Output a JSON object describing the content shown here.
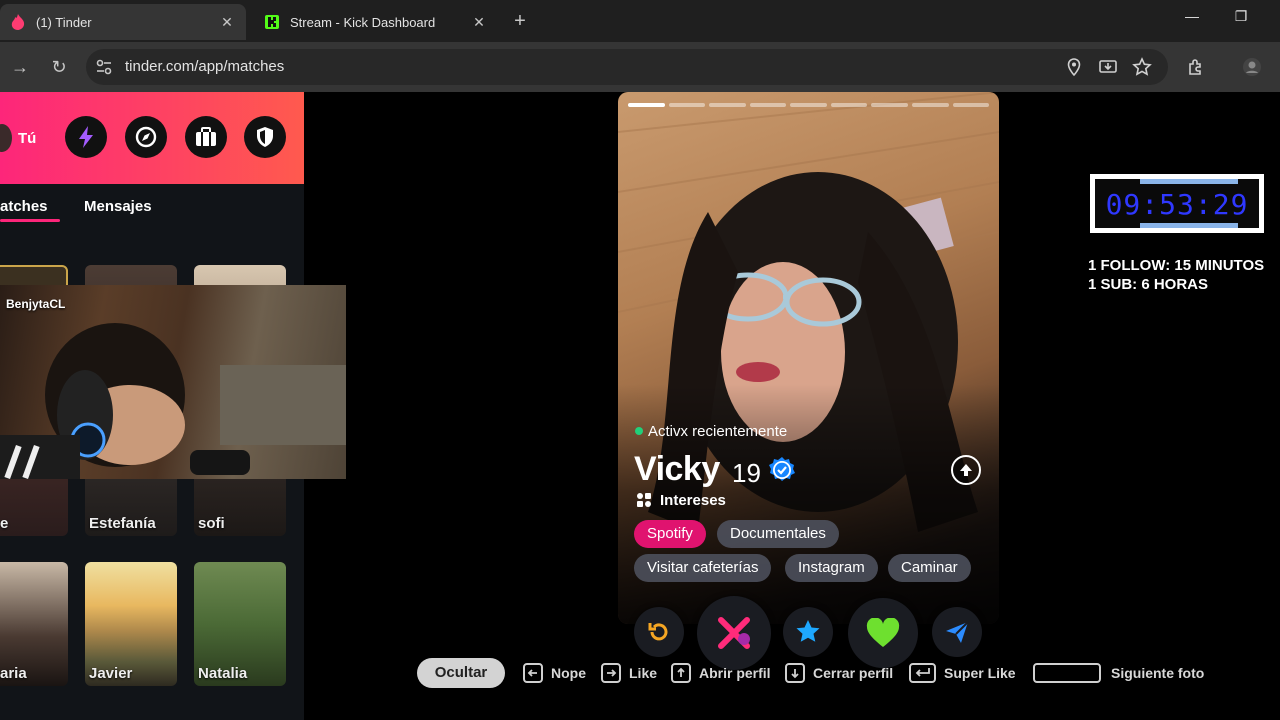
{
  "browser": {
    "tabs": [
      {
        "title": "(1) Tinder",
        "active": true,
        "icon": "tinder-flame-icon"
      },
      {
        "title": "Stream - Kick Dashboard",
        "active": false,
        "icon": "kick-logo-icon"
      }
    ],
    "url": "tinder.com/app/matches"
  },
  "sidebar": {
    "user_label": "Tú",
    "tabs": [
      "Matches",
      "Mensajes"
    ],
    "active_tab": "Matches",
    "matches_tab_visible": "atches",
    "cards_row2": [
      {
        "name": "e"
      },
      {
        "name": "Estefanía"
      },
      {
        "name": "sofi"
      }
    ],
    "cards_row3": [
      {
        "name": "aria"
      },
      {
        "name": "Javier"
      },
      {
        "name": "Natalia"
      }
    ]
  },
  "webcam": {
    "channel": "BenjytaCL"
  },
  "profile": {
    "status": "Activx recientemente",
    "name": "Vicky",
    "age": "19",
    "interests_label": "Intereses",
    "interests": [
      "Spotify",
      "Documentales",
      "Visitar cafeterías",
      "Instagram",
      "Caminar"
    ],
    "highlighted_interest": "Spotify",
    "photo_count": 9,
    "current_photo": 1
  },
  "actions": [
    "rewind-icon",
    "nope-icon",
    "super-like-icon",
    "like-icon",
    "boost-icon"
  ],
  "shortcuts": {
    "hide_label": "Ocultar",
    "nope": "Nope",
    "like": "Like",
    "open_profile": "Abrir perfil",
    "close_profile": "Cerrar perfil",
    "super_like": "Super Like",
    "next_photo": "Siguiente foto"
  },
  "stream_overlay": {
    "timer": "09:53:29",
    "rule1": "1 FOLLOW: 15 MINUTOS",
    "rule2": "1 SUB: 6 HORAS"
  },
  "colors": {
    "tinder_gradient_start": "#fd267a",
    "tinder_gradient_end": "#ff5a4e",
    "timer_digits": "#2f38ff",
    "chip_highlight": "#e0136f"
  }
}
